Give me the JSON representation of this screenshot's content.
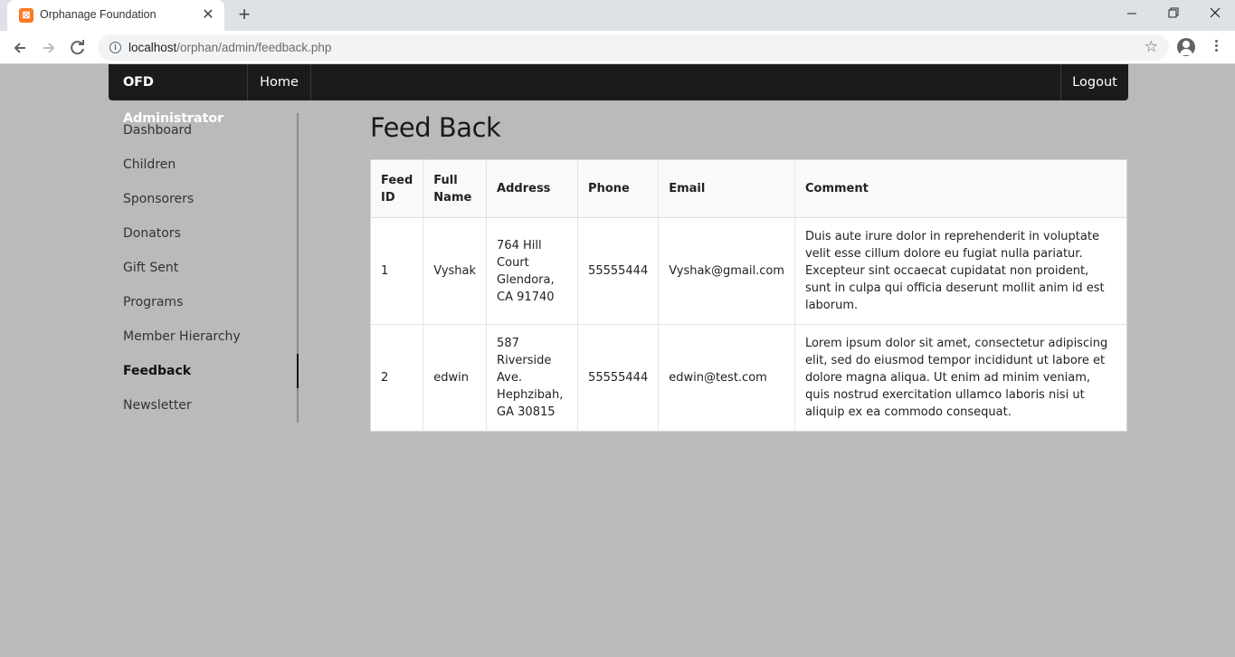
{
  "browser": {
    "tab_title": "Orphanage Foundation",
    "url_host": "localhost",
    "url_path": "/orphan/admin/feedback.php"
  },
  "navbar": {
    "brand": "OFD Administrator",
    "home": "Home",
    "logout": "Logout"
  },
  "sidebar": {
    "items": [
      {
        "label": "Dashboard"
      },
      {
        "label": "Children"
      },
      {
        "label": "Sponsorers"
      },
      {
        "label": "Donators"
      },
      {
        "label": "Gift Sent"
      },
      {
        "label": "Programs"
      },
      {
        "label": "Member Hierarchy"
      },
      {
        "label": "Feedback",
        "active": true
      },
      {
        "label": "Newsletter"
      }
    ]
  },
  "main": {
    "title": "Feed Back",
    "table": {
      "headers": [
        "Feed ID",
        "Full Name",
        "Address",
        "Phone",
        "Email",
        "Comment"
      ],
      "rows": [
        {
          "id": "1",
          "name": "Vyshak",
          "address": "764 Hill Court Glendora, CA 91740",
          "phone": "55555444",
          "email": "Vyshak@gmail.com",
          "comment": "Duis aute irure dolor in reprehenderit in voluptate velit esse cillum dolore eu fugiat nulla pariatur. Excepteur sint occaecat cupidatat non proident, sunt in culpa qui officia deserunt mollit anim id est laborum."
        },
        {
          "id": "2",
          "name": "edwin",
          "address": "587 Riverside Ave. Hephzibah, GA 30815",
          "phone": "55555444",
          "email": "edwin@test.com",
          "comment": "Lorem ipsum dolor sit amet, consectetur adipiscing elit, sed do eiusmod tempor incididunt ut labore et dolore magna aliqua. Ut enim ad minim veniam, quis nostrud exercitation ullamco laboris nisi ut aliquip ex ea commodo consequat."
        }
      ]
    }
  }
}
